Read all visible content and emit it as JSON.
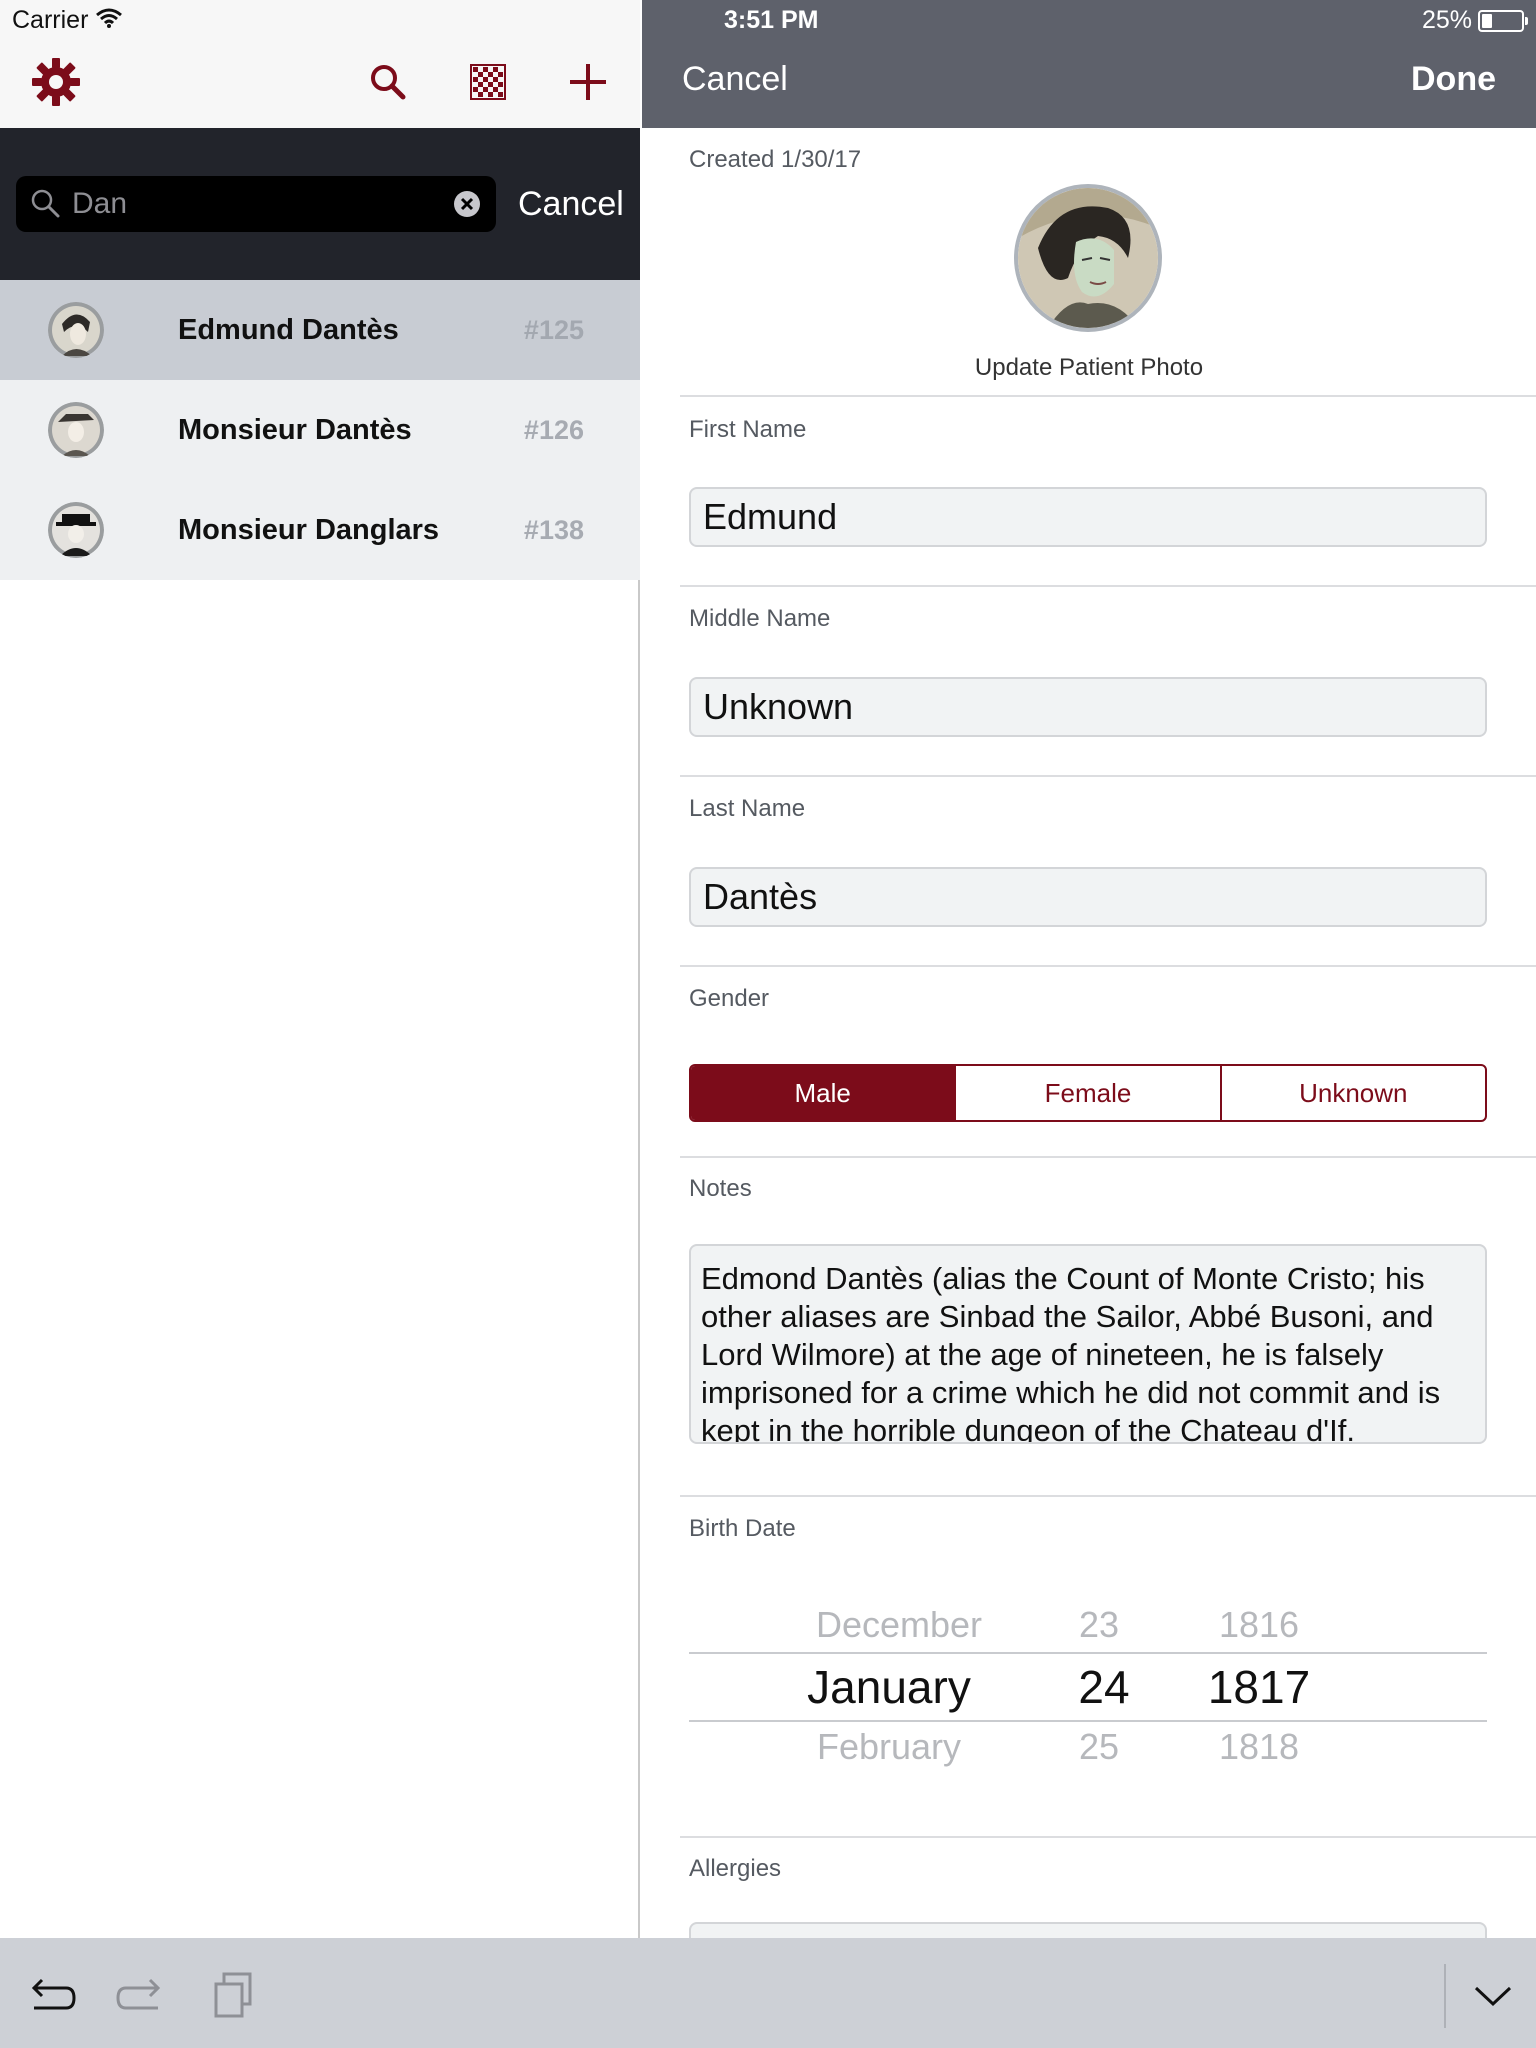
{
  "status_bar": {
    "carrier": "Carrier",
    "time": "3:51 PM",
    "battery": "25%",
    "battery_level": 0.25
  },
  "left_toolbar": {
    "icons": [
      "gear-icon",
      "search-icon",
      "checkerboard-icon",
      "plus-icon"
    ],
    "accent_color": "#7c0c1a"
  },
  "search": {
    "value": "Dan",
    "cancel_label": "Cancel"
  },
  "results": [
    {
      "name": "Edmund Dantès",
      "number": "#125",
      "selected": true
    },
    {
      "name": "Monsieur Dantès",
      "number": "#126",
      "selected": false
    },
    {
      "name": "Monsieur Danglars",
      "number": "#138",
      "selected": false
    }
  ],
  "editor": {
    "cancel_label": "Cancel",
    "done_label": "Done",
    "created": "Created 1/30/17",
    "update_photo_label": "Update Patient Photo",
    "first_name": {
      "label": "First Name",
      "value": "Edmund"
    },
    "middle_name": {
      "label": "Middle Name",
      "value": "Unknown"
    },
    "last_name": {
      "label": "Last Name",
      "value": "Dantès"
    },
    "gender": {
      "label": "Gender",
      "options": [
        "Male",
        "Female",
        "Unknown"
      ],
      "selected": "Male"
    },
    "notes": {
      "label": "Notes",
      "value": "Edmond Dantès (alias the Count of Monte Cristo; his other aliases are Sinbad the Sailor, Abbé Busoni, and Lord Wilmore) at the age of nineteen, he is falsely imprisoned for a crime which he did not commit and is kept in the horrible dungeon of the Chateau d'If."
    },
    "birth_date": {
      "label": "Birth Date",
      "months": {
        "prev": "December",
        "current": "January",
        "next": "February"
      },
      "days": {
        "prev": "23",
        "current": "24",
        "next": "25"
      },
      "years": {
        "prev": "1816",
        "current": "1817",
        "next": "1818"
      }
    },
    "allergies": {
      "label": "Allergies"
    }
  },
  "keyboard_bar": {
    "icons": [
      "undo-icon",
      "redo-icon",
      "paste-icon",
      "hide-keyboard-icon"
    ]
  }
}
